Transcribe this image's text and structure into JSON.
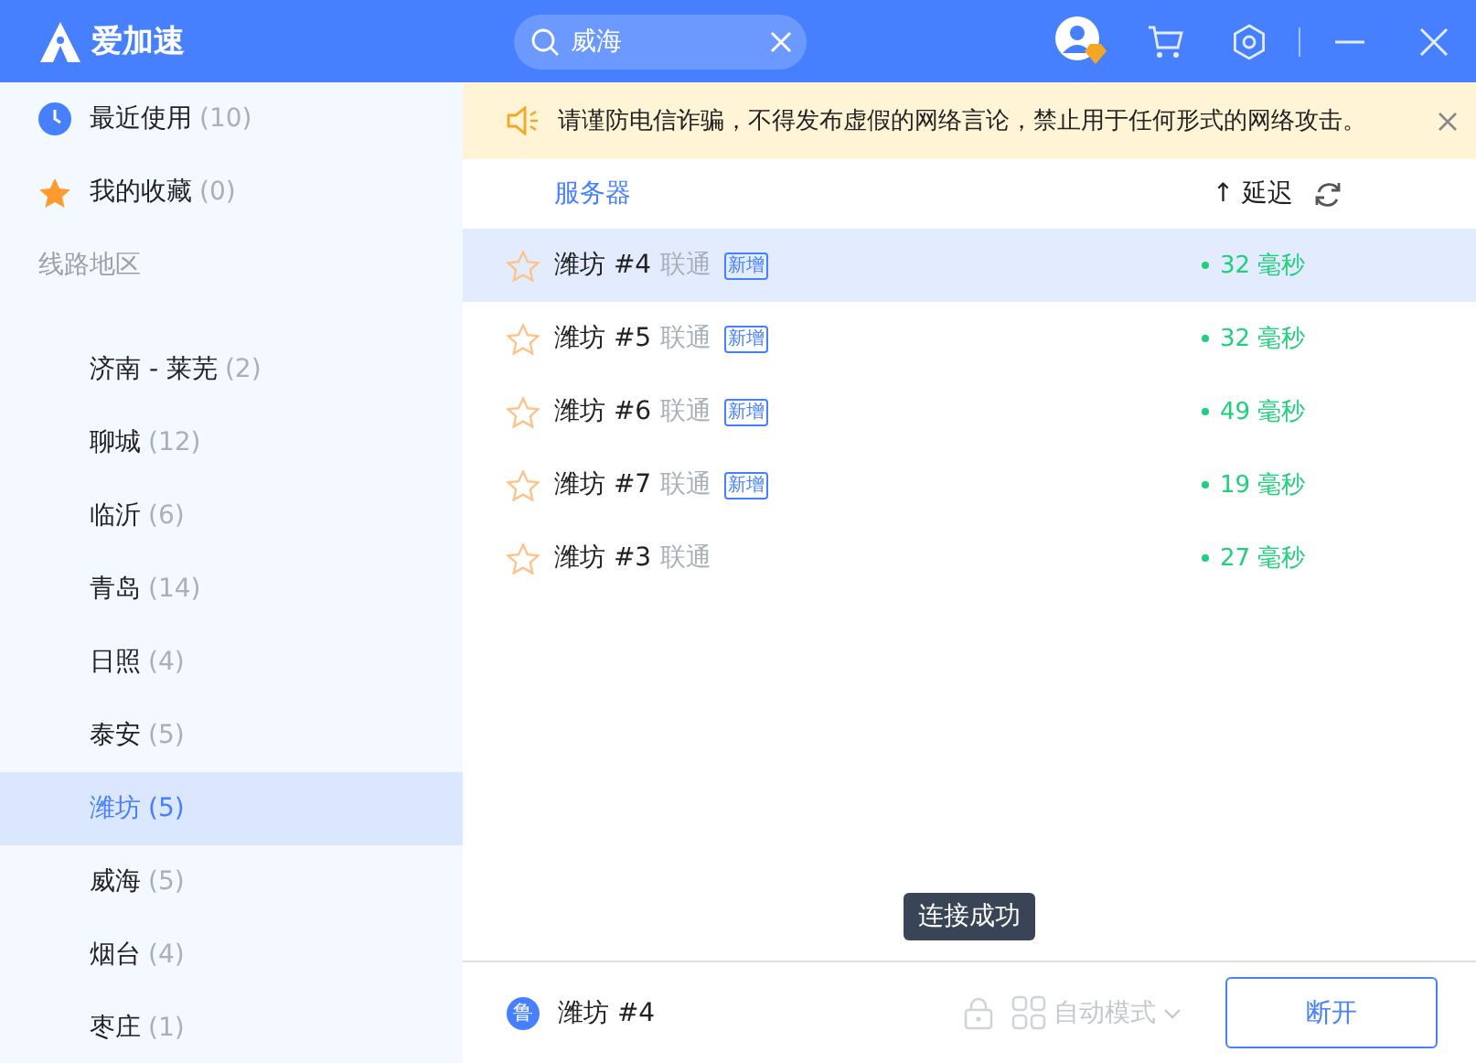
{
  "app": {
    "title": "爱加速"
  },
  "search": {
    "value": "威海"
  },
  "sidebar": {
    "shortcuts": [
      {
        "kind": "recent",
        "label": "最近使用",
        "count": "(10)"
      },
      {
        "kind": "favorites",
        "label": "我的收藏",
        "count": "(0)"
      }
    ],
    "section_label": "线路地区",
    "regions": [
      {
        "name": "济南 - 莱芜",
        "count": "(2)",
        "selected": false
      },
      {
        "name": "聊城",
        "count": "(12)",
        "selected": false
      },
      {
        "name": "临沂",
        "count": "(6)",
        "selected": false
      },
      {
        "name": "青岛",
        "count": "(14)",
        "selected": false
      },
      {
        "name": "日照",
        "count": "(4)",
        "selected": false
      },
      {
        "name": "泰安",
        "count": "(5)",
        "selected": false
      },
      {
        "name": "潍坊",
        "count": "(5)",
        "selected": true
      },
      {
        "name": "威海",
        "count": "(5)",
        "selected": false
      },
      {
        "name": "烟台",
        "count": "(4)",
        "selected": false
      },
      {
        "name": "枣庄",
        "count": "(1)",
        "selected": false
      }
    ]
  },
  "notice": {
    "text": "请谨防电信诈骗，不得发布虚假的网络言论，禁止用于任何形式的网络攻击。"
  },
  "server_list": {
    "columns": {
      "name": "服务器",
      "latency": "↑ 延迟"
    },
    "rows": [
      {
        "name": "潍坊 #4",
        "isp": "联通",
        "tag": "新增",
        "latency": "32 毫秒",
        "selected": true
      },
      {
        "name": "潍坊 #5",
        "isp": "联通",
        "tag": "新增",
        "latency": "32 毫秒",
        "selected": false
      },
      {
        "name": "潍坊 #6",
        "isp": "联通",
        "tag": "新增",
        "latency": "49 毫秒",
        "selected": false
      },
      {
        "name": "潍坊 #7",
        "isp": "联通",
        "tag": "新增",
        "latency": "19 毫秒",
        "selected": false
      },
      {
        "name": "潍坊 #3",
        "isp": "联通",
        "latency": "27 毫秒",
        "selected": false
      }
    ]
  },
  "toast": {
    "text": "连接成功"
  },
  "footer": {
    "region_badge": "鲁",
    "current": "潍坊 #4",
    "mode": "自动模式",
    "button": "断开"
  }
}
